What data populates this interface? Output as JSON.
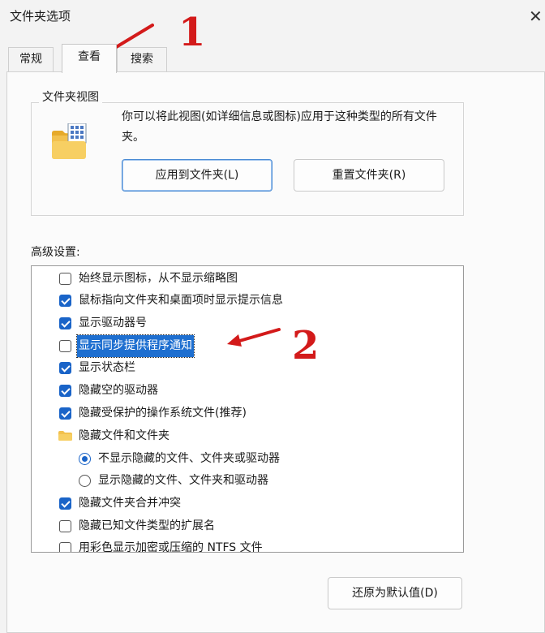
{
  "window": {
    "title": "文件夹选项",
    "close_glyph": "✕"
  },
  "tabs": [
    {
      "label": "常规",
      "active": false
    },
    {
      "label": "查看",
      "active": true
    },
    {
      "label": "搜索",
      "active": false
    }
  ],
  "folder_views": {
    "group_title": "文件夹视图",
    "description": "你可以将此视图(如详细信息或图标)应用于这种类型的所有文件夹。",
    "apply_button": "应用到文件夹(L)",
    "reset_button": "重置文件夹(R)"
  },
  "advanced": {
    "label": "高级设置:",
    "items": [
      {
        "type": "checkbox",
        "checked": false,
        "label": "始终显示图标，从不显示缩略图"
      },
      {
        "type": "checkbox",
        "checked": true,
        "label": "鼠标指向文件夹和桌面项时显示提示信息"
      },
      {
        "type": "checkbox",
        "checked": true,
        "label": "显示驱动器号"
      },
      {
        "type": "checkbox",
        "checked": false,
        "label": "显示同步提供程序通知",
        "selected": true
      },
      {
        "type": "checkbox",
        "checked": true,
        "label": "显示状态栏"
      },
      {
        "type": "checkbox",
        "checked": true,
        "label": "隐藏空的驱动器"
      },
      {
        "type": "checkbox",
        "checked": true,
        "label": "隐藏受保护的操作系统文件(推荐)"
      },
      {
        "type": "folder",
        "label": "隐藏文件和文件夹"
      },
      {
        "type": "radio",
        "checked": true,
        "label": "不显示隐藏的文件、文件夹或驱动器"
      },
      {
        "type": "radio",
        "checked": false,
        "label": "显示隐藏的文件、文件夹和驱动器"
      },
      {
        "type": "checkbox",
        "checked": true,
        "label": "隐藏文件夹合并冲突"
      },
      {
        "type": "checkbox",
        "checked": false,
        "label": "隐藏已知文件类型的扩展名"
      },
      {
        "type": "checkbox",
        "checked": false,
        "label": "用彩色显示加密或压缩的 NTFS 文件"
      }
    ]
  },
  "restore_defaults_button": "还原为默认值(D)",
  "annotations": {
    "one": "1",
    "two": "2"
  },
  "colors": {
    "accent": "#1a64c8",
    "annotation": "#d31a1a",
    "selection": "#1e6fd0"
  },
  "icons": {
    "folder_view": "folder-grid-icon",
    "folder": "folder-icon",
    "close": "close-icon"
  }
}
